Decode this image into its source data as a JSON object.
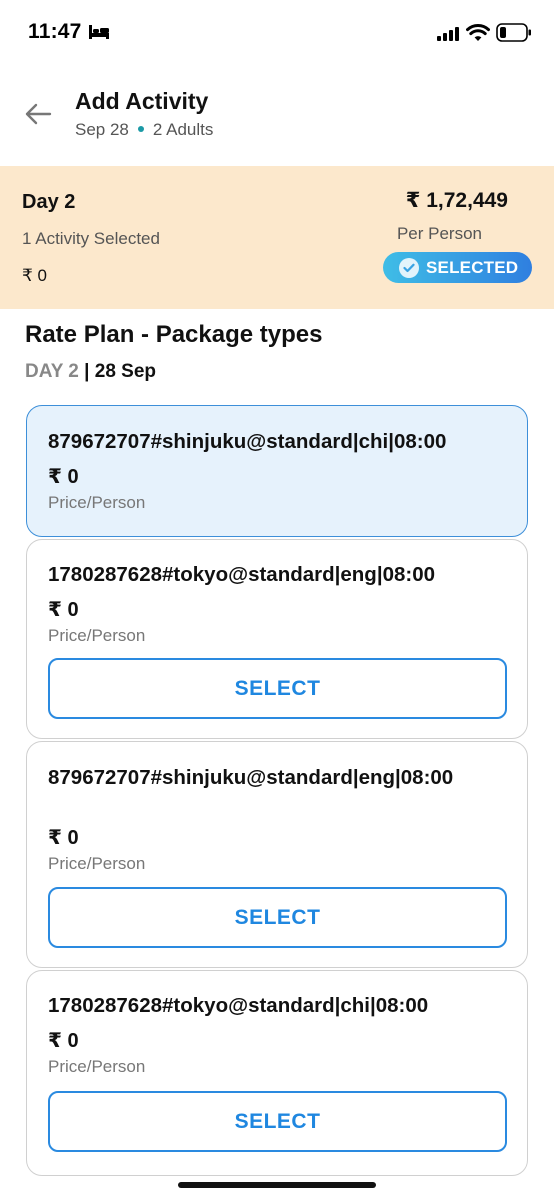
{
  "status_bar": {
    "time": "11:47"
  },
  "header": {
    "title": "Add Activity",
    "date": "Sep 28",
    "guests": "2 Adults"
  },
  "day_summary": {
    "day": "Day 2",
    "activities_selected": "1 Activity Selected",
    "day_price": "₹ 0",
    "total_price": "₹ 1,72,449",
    "per_person": "Per Person",
    "badge": "SELECTED"
  },
  "rate_plan": {
    "title": "Rate Plan - Package types",
    "day": "DAY 2",
    "separator": " | ",
    "date": "28 Sep"
  },
  "packages": [
    {
      "name": "879672707#shinjuku@standard|chi|08:00",
      "price": "₹ 0",
      "price_unit": "Price/Person",
      "selected": true
    },
    {
      "name": "1780287628#tokyo@standard|eng|08:00",
      "price": "₹ 0",
      "price_unit": "Price/Person",
      "button": "SELECT"
    },
    {
      "name": "879672707#shinjuku@standard|eng|08:00",
      "price": "₹ 0",
      "price_unit": "Price/Person",
      "button": "SELECT"
    },
    {
      "name": "1780287628#tokyo@standard|chi|08:00",
      "price": "₹ 0",
      "price_unit": "Price/Person",
      "button": "SELECT"
    }
  ],
  "colors": {
    "accent": "#1f87e0",
    "summary_bg": "#fce8cc",
    "selected_card_bg": "#e6f2fc"
  }
}
